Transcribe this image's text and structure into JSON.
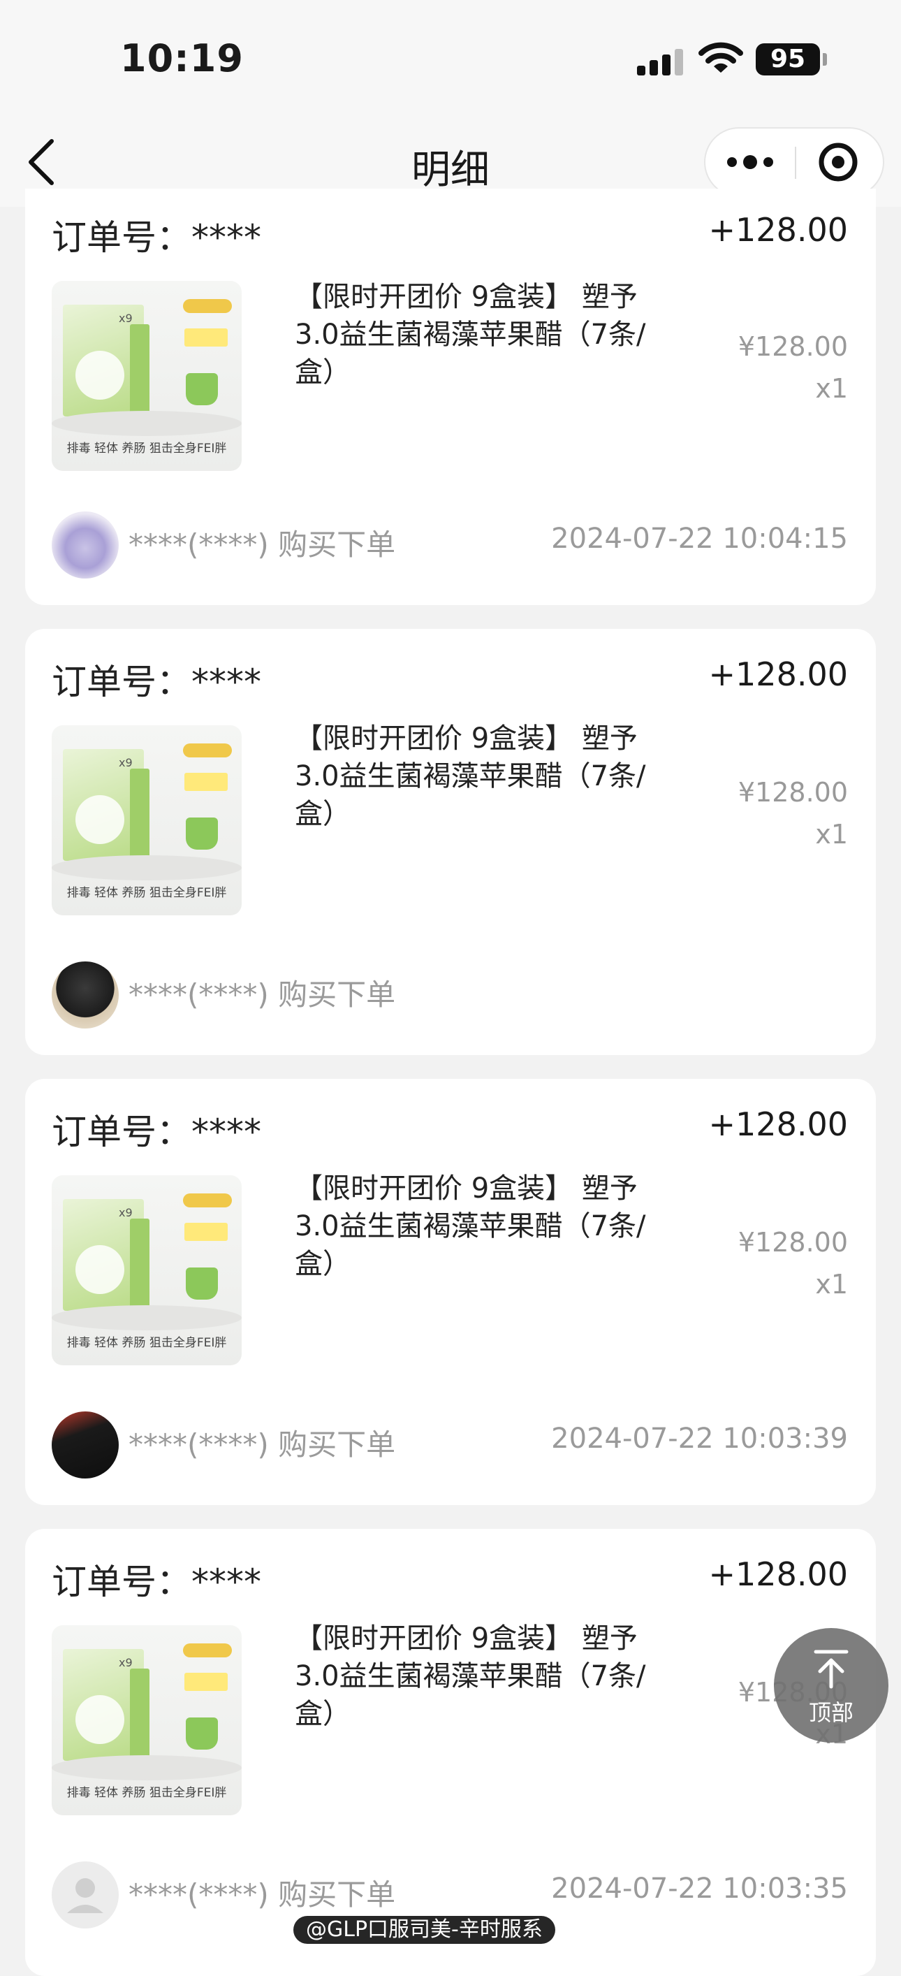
{
  "status_bar": {
    "time": "10:19",
    "battery": "95",
    "icons": [
      "cellular-signal-icon",
      "wifi-icon",
      "battery-icon"
    ]
  },
  "nav": {
    "title": "明细",
    "back_icon": "chevron-left-icon",
    "more_icon": "more-dots-icon",
    "close_icon": "target-circle-icon"
  },
  "orders": [
    {
      "order_label": "订单号：****",
      "amount": "+128.00",
      "product_title": "【限时开团价 9盒装】 塑予3.0益生菌褐藻苹果醋（7条/盒）",
      "thumb_badge": "x9",
      "thumb_caption": "排毒 轻体 养肠 狙击全身FEI胖",
      "unit_price": "¥128.00",
      "qty": "x1",
      "buyer": "****(****) 购买下单",
      "time": "2024-07-22 10:04:15",
      "avatar": "avatar-bunny-plush"
    },
    {
      "order_label": "订单号：****",
      "amount": "+128.00",
      "product_title": "【限时开团价 9盒装】 塑予3.0益生菌褐藻苹果醋（7条/盒）",
      "thumb_badge": "x9",
      "thumb_caption": "排毒 轻体 养肠 狙击全身FEI胖",
      "unit_price": "¥128.00",
      "qty": "x1",
      "buyer": "****(****) 购买下单",
      "time": "",
      "avatar": "avatar-person-dark"
    },
    {
      "order_label": "订单号：****",
      "amount": "+128.00",
      "product_title": "【限时开团价 9盒装】 塑予3.0益生菌褐藻苹果醋（7条/盒）",
      "thumb_badge": "x9",
      "thumb_caption": "排毒 轻体 养肠 狙击全身FEI胖",
      "unit_price": "¥128.00",
      "qty": "x1",
      "buyer": "****(****) 购买下单",
      "time": "2024-07-22 10:03:39",
      "avatar": "avatar-dark-screen"
    },
    {
      "order_label": "订单号：****",
      "amount": "+128.00",
      "product_title": "【限时开团价 9盒装】 塑予3.0益生菌褐藻苹果醋（7条/盒）",
      "thumb_badge": "x9",
      "thumb_caption": "排毒 轻体 养肠 狙击全身FEI胖",
      "unit_price": "¥128.00",
      "qty": "x1",
      "buyer": "****(****) 购买下单",
      "time": "2024-07-22 10:03:35",
      "avatar": "avatar-default-person"
    }
  ],
  "scroll_top": {
    "label": "顶部",
    "icon": "arrow-to-top-icon"
  },
  "watermark": "@GLP口服司美-辛时服系"
}
